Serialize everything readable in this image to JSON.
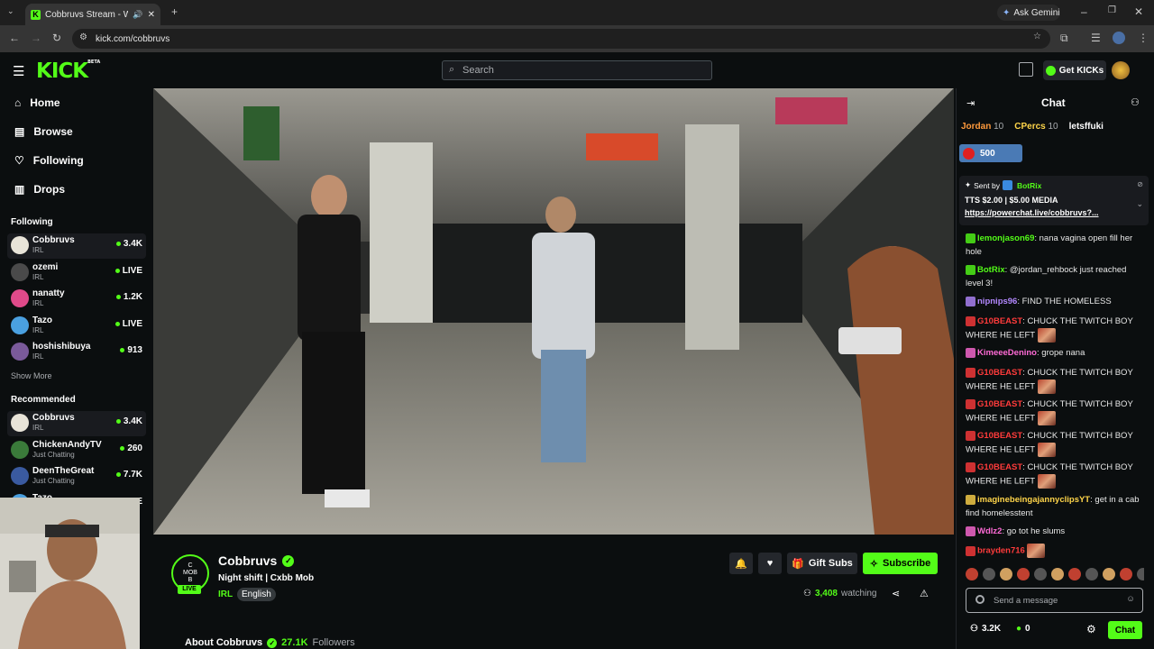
{
  "browser": {
    "tab_title": "Cobbruvs Stream - Watch L",
    "url": "kick.com/cobbruvs",
    "ask_gemini": "Ask Gemini"
  },
  "header": {
    "logo": "KICK",
    "logo_sup": "BETA",
    "search_placeholder": "Search",
    "get_kicks": "Get KICKs"
  },
  "sidebar": {
    "nav": [
      {
        "label": "Home",
        "icon": "home-icon"
      },
      {
        "label": "Browse",
        "icon": "browse-icon"
      },
      {
        "label": "Following",
        "icon": "heart-icon"
      },
      {
        "label": "Drops",
        "icon": "drops-icon"
      }
    ],
    "following_title": "Following",
    "following": [
      {
        "name": "Cobbruvs",
        "category": "IRL",
        "viewers": "3.4K",
        "color": "#e8e4d8"
      },
      {
        "name": "ozemi",
        "category": "IRL",
        "viewers": "LIVE",
        "color": "#4a4a4a"
      },
      {
        "name": "nanatty",
        "category": "IRL",
        "viewers": "1.2K",
        "color": "#e04a8a"
      },
      {
        "name": "Tazo",
        "category": "IRL",
        "viewers": "LIVE",
        "color": "#4aa0e0"
      },
      {
        "name": "hoshishibuya",
        "category": "IRL",
        "viewers": "913",
        "color": "#7a5a9a"
      }
    ],
    "show_more": "Show More",
    "recommended_title": "Recommended",
    "recommended": [
      {
        "name": "Cobbruvs",
        "category": "IRL",
        "viewers": "3.4K",
        "color": "#e8e4d8"
      },
      {
        "name": "ChickenAndyTV",
        "category": "Just Chatting",
        "viewers": "260",
        "color": "#3a7a3a"
      },
      {
        "name": "DeenTheGreat",
        "category": "Just Chatting",
        "viewers": "7.7K",
        "color": "#3a5aa0"
      },
      {
        "name": "Tazo",
        "category": "",
        "viewers": "LIVE",
        "color": "#4aa0e0"
      }
    ]
  },
  "channel": {
    "name": "Cobbruvs",
    "title": "Night shift | Cxbb Mob",
    "category": "IRL",
    "language": "English",
    "live_badge": "LIVE",
    "avatar_text": "C\nMOB\nB",
    "gift_subs": "Gift Subs",
    "subscribe": "Subscribe",
    "watching_count": "3,408",
    "watching_label": "watching",
    "about": "About Cobbruvs",
    "followers_count": "27.1K",
    "followers_label": "Followers"
  },
  "chat": {
    "title": "Chat",
    "leaderboard": [
      {
        "name": "Jordan",
        "score": "10"
      },
      {
        "name": "CPercs",
        "score": "10"
      },
      {
        "name": "letsffuki",
        "score": ""
      }
    ],
    "goal": "500",
    "pinned": {
      "sent_by_label": "Sent by",
      "sender": "BotRix",
      "text": "TTS $2.00 | $5.00 MEDIA",
      "link": "https://powerchat.live/cobbruvs?..."
    },
    "messages": [
      {
        "user": "lemonjason69",
        "color": "#53fc18",
        "text": "nana vagina open fill her hole"
      },
      {
        "user": "BotRix",
        "color": "#53fc18",
        "text": "@jordan_rehbock just reached level 3!"
      },
      {
        "user": "nipnips96",
        "color": "#b388ff",
        "text": "FIND THE HOMELESS"
      },
      {
        "user": "G10BEAST",
        "color": "#ff3b3b",
        "text": "CHUCK THE TWITCH BOY WHERE HE LEFT"
      },
      {
        "user": "KimeeeDenino",
        "color": "#ff6bd6",
        "text": "grope nana"
      },
      {
        "user": "G10BEAST",
        "color": "#ff3b3b",
        "text": "CHUCK THE TWITCH BOY WHERE HE LEFT"
      },
      {
        "user": "G10BEAST",
        "color": "#ff3b3b",
        "text": "CHUCK THE TWITCH BOY WHERE HE LEFT"
      },
      {
        "user": "G10BEAST",
        "color": "#ff3b3b",
        "text": "CHUCK THE TWITCH BOY WHERE HE LEFT"
      },
      {
        "user": "G10BEAST",
        "color": "#ff3b3b",
        "text": "CHUCK THE TWITCH BOY WHERE HE LEFT"
      },
      {
        "user": "imaginebeingajannyclipsYT",
        "color": "#ffd54a",
        "text": "get in a cab find homelesstent"
      },
      {
        "user": "Wdlz2",
        "color": "#ff6bd6",
        "text": "go tot he slums"
      },
      {
        "user": "brayden716",
        "color": "#ff3b3b",
        "text": ""
      }
    ],
    "input_placeholder": "Send a message",
    "viewer_count": "3.2K",
    "kicks_count": "0",
    "chat_button": "Chat"
  }
}
